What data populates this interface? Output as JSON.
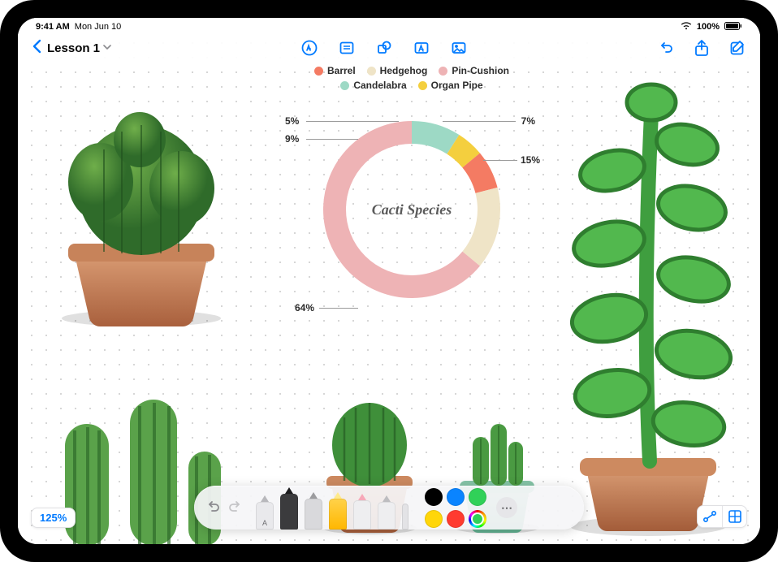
{
  "status": {
    "time": "9:41 AM",
    "date": "Mon Jun 10",
    "battery_pct": "100%"
  },
  "nav": {
    "doc_title": "Lesson 1",
    "tools": {
      "pen": "Draw",
      "note": "Sticky Note",
      "shape": "Shapes",
      "text": "Text Box",
      "media": "Media"
    },
    "right": {
      "undo": "Undo",
      "share": "Share",
      "compose": "Edit"
    }
  },
  "chart_data": {
    "type": "pie",
    "title": "Cacti Species",
    "series": [
      {
        "name": "Barrel",
        "value": 7,
        "color": "#f47b63"
      },
      {
        "name": "Hedgehog",
        "value": 15,
        "color": "#efe4c7"
      },
      {
        "name": "Pin-Cushion",
        "value": 64,
        "color": "#eeb3b5"
      },
      {
        "name": "Candelabra",
        "value": 9,
        "color": "#9dd9c5"
      },
      {
        "name": "Organ Pipe",
        "value": 5,
        "color": "#f4cf3e"
      }
    ],
    "labels": {
      "barrel": "7%",
      "hedgehog": "15%",
      "pincushion": "64%",
      "candelabra": "9%",
      "organpipe": "5%"
    }
  },
  "palette": {
    "colors": [
      "#000000",
      "#0a84ff",
      "#30d158",
      "#ffd60a",
      "#ff3b30"
    ],
    "selected_color": "#30d158"
  },
  "zoom": {
    "level": "125%"
  }
}
